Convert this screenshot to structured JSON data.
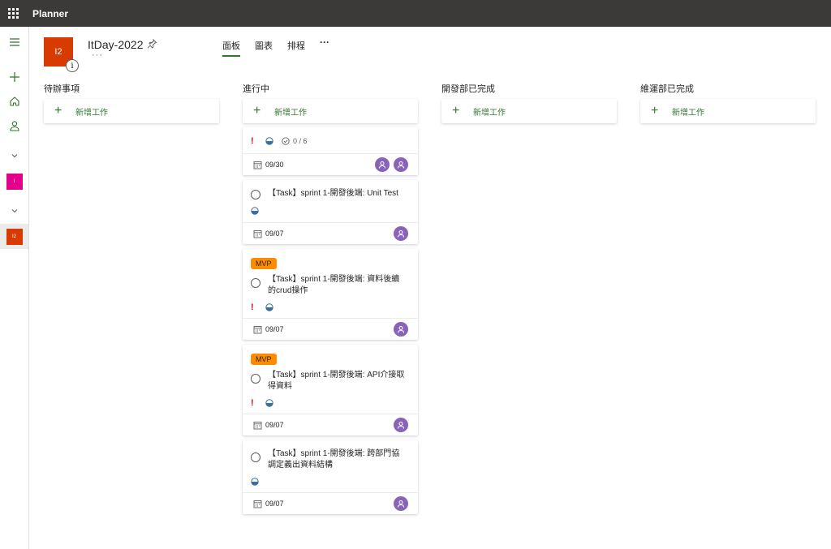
{
  "app": {
    "name": "Planner"
  },
  "plan": {
    "logo_text": "I2",
    "title": "ItDay-2022",
    "more": "···",
    "info": "i"
  },
  "tabs": [
    {
      "label": "面板",
      "active": true
    },
    {
      "label": "圖表",
      "active": false
    },
    {
      "label": "排程",
      "active": false
    }
  ],
  "tabs_more": "···",
  "rail": {
    "plan1": "I",
    "plan2": "I2"
  },
  "colors": {
    "accent": "#31752f",
    "topbar": "#3b3a39",
    "plan_logo": "#d83b01",
    "plan1_chip": "#e3008c",
    "avatar": "#8764b8",
    "label_mvp": "#ff8c00",
    "priority": "#c50f1f"
  },
  "buckets": [
    {
      "name": "待辦事項",
      "add_label": "新增工作"
    },
    {
      "name": "進行中",
      "add_label": "新增工作"
    },
    {
      "name": "開發部已完成",
      "add_label": "新增工作"
    },
    {
      "name": "維運部已完成",
      "add_label": "新增工作"
    }
  ],
  "cards": [
    {
      "priority": "!",
      "checklist": "0 / 6",
      "due": "09/30",
      "assignees": 2
    },
    {
      "title": "【Task】sprint 1-開發後端: Unit Test",
      "due": "09/07",
      "assignees": 1
    },
    {
      "label": "MVP",
      "title": "【Task】sprint 1-開發後端: 資料後續的crud操作",
      "priority": "!",
      "due": "09/07",
      "assignees": 1
    },
    {
      "label": "MVP",
      "title": "【Task】sprint 1-開發後端: API介接取得資料",
      "priority": "!",
      "due": "09/07",
      "assignees": 1
    },
    {
      "title": "【Task】sprint 1-開發後端: 跨部門協調定義出資料結構",
      "due": "09/07",
      "assignees": 1
    }
  ]
}
